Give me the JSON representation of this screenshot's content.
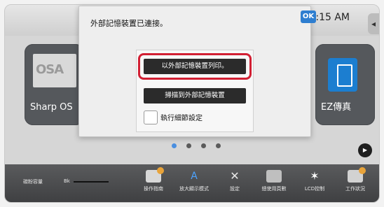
{
  "status": {
    "time": "10:15 AM"
  },
  "dialog": {
    "message": "外部記憶裝置已連接。",
    "ok_label": "OK",
    "options": [
      {
        "label": "以外部記憶裝置列印。"
      },
      {
        "label": "掃描到外部記憶裝置"
      }
    ],
    "checkbox_label": "執行細節設定"
  },
  "home": {
    "left_tile_label": "Sharp OS",
    "left_tile_art": "OSA",
    "right_tile_label": "EZ傳真",
    "play_icon": "▶"
  },
  "bottom_bar": {
    "toner_label": "碳粉容量",
    "toner_bk": "Bk",
    "buttons": [
      {
        "label": "操作指南"
      },
      {
        "label": "放大顯示模式"
      },
      {
        "label": "設定"
      },
      {
        "label": "總使用頁數"
      },
      {
        "label": "LCD控制"
      },
      {
        "label": "工作狀況"
      }
    ]
  },
  "colors": {
    "accent_blue": "#2e7ed0",
    "highlight_red": "#d21f33",
    "panel_gray": "#d6d6d6",
    "bottom_bar_dark": "#3e3f41",
    "badge_orange": "#e8a33a"
  }
}
